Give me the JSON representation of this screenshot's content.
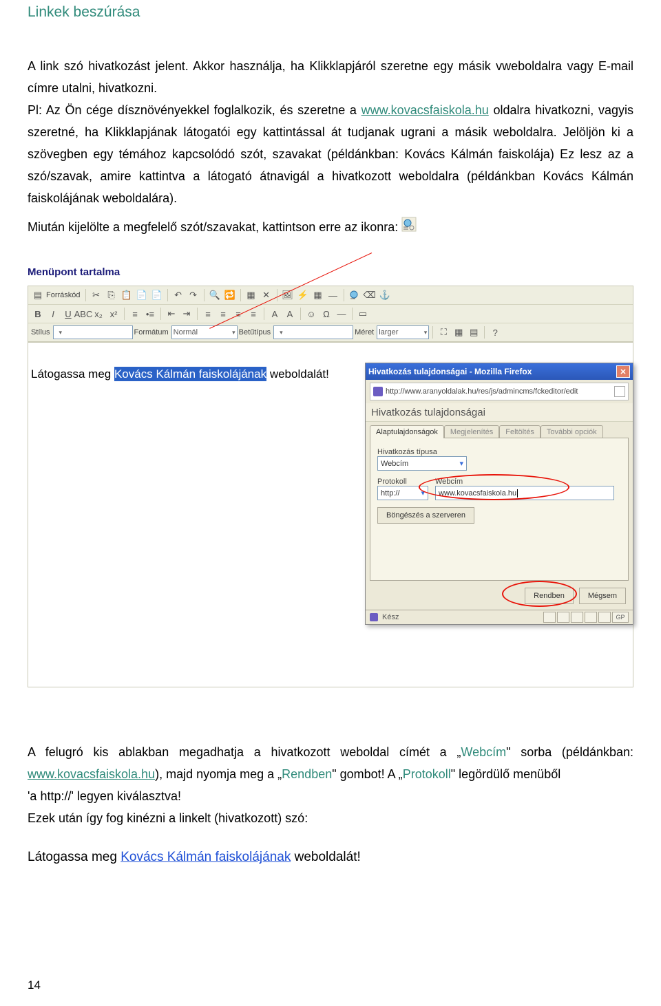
{
  "heading": "Linkek beszúrása",
  "paragraph": "A link szó hivatkozást jelent. Akkor használja, ha Klikklapjáról szeretne egy másik vweboldalra vagy E-mail címre utalni, hivatkozni.\nPl: Az Ön cége dísznövényekkel foglalkozik, és szeretne a www.kovacsfaiskola.hu oldalra hivatkozni, vagyis szeretné, ha Klikklapjának látogatói egy kattintással át tudjanak ugrani a másik weboldalra. Jelöljön ki a szövegben egy témához kapcsolódó szót, szavakat (példánkban: Kovács Kálmán faiskolája) Ez lesz az a szó/szavak, amire kattintva a látogató átnavigál a hivatkozott weboldalra (példánkban Kovács Kálmán faiskolájának weboldalára).",
  "icon_line": "Miután kijelölte a megfelelő szót/szavakat, kattintson erre az ikonra:",
  "editor_title": "Menüpont tartalma",
  "toolbar_labels": {
    "source": "Forráskód",
    "style": "Stílus",
    "format": "Formátum",
    "format_value": "Normál",
    "font": "Betűtípus",
    "size": "Méret",
    "size_value": "larger"
  },
  "editor_sample": {
    "pre": "Látogassa meg ",
    "sel": "Kovács Kálmán faiskolájának",
    "post": " weboldalát!"
  },
  "dialog": {
    "title": "Hivatkozás tulajdonságai - Mozilla Firefox",
    "address": "http://www.aranyoldalak.hu/res/js/admincms/fckeditor/edit",
    "header": "Hivatkozás tulajdonságai",
    "tabs": [
      "Alaptulajdonságok",
      "Megjelenítés",
      "Feltöltés",
      "További opciók"
    ],
    "type_label": "Hivatkozás típusa",
    "type_value": "Webcím",
    "protocol_label": "Protokoll",
    "protocol_value": "http://",
    "url_label": "Webcím",
    "url_value": "www.kovacsfaiskola.hu",
    "browse_btn": "Böngészés a szerveren",
    "ok": "Rendben",
    "cancel": "Mégsem",
    "status": "Kész",
    "status_gp": "GP"
  },
  "after_text": {
    "l1_pre": "A felugró kis ablakban megadhatja a hivatkozott weboldal címét a „",
    "l1_webc": "Webcím",
    "l1_post": "\" sorba (példánkban:",
    "l2_link": "www.kovacsfaiskola.hu",
    "l2_mid": "), majd nyomja meg a „",
    "l2_rend": "Rendben",
    "l2_post": "\" gombot! A „",
    "l2_proto": "Protokoll",
    "l2_end": "\" legördülő menüből",
    "l3": "'a http://' legyen kiválasztva!",
    "l4": "Ezek után így fog kinézni a linkelt (hivatkozott) szó:"
  },
  "sample2": {
    "pre": "Látogassa meg ",
    "link": "Kovács Kálmán faiskolájának",
    "post": " weboldalát!"
  },
  "page_number": "14"
}
